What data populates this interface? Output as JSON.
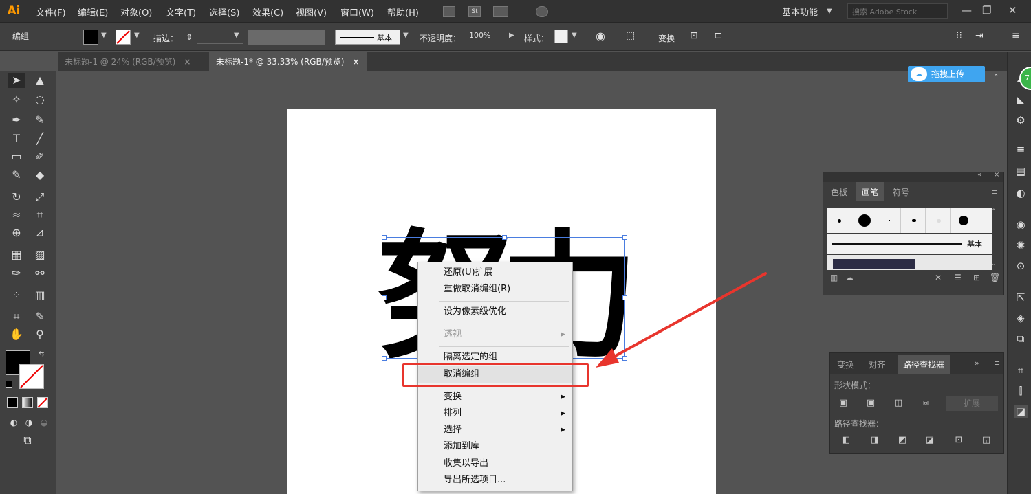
{
  "app": {
    "logo": "Ai"
  },
  "menubar": {
    "items": [
      "文件(F)",
      "编辑(E)",
      "对象(O)",
      "文字(T)",
      "选择(S)",
      "效果(C)",
      "视图(V)",
      "窗口(W)",
      "帮助(H)"
    ],
    "st_label": "St",
    "workspace": "基本功能",
    "search_placeholder": "搜索 Adobe Stock",
    "window_controls": [
      "—",
      "❐",
      "✕"
    ]
  },
  "control_bar": {
    "mode_label": "编组",
    "stroke_label": "描边：",
    "profile_label": "基本",
    "opacity_label": "不透明度：",
    "opacity_value": "100%",
    "style_label": "样式：",
    "transform_label": "变换"
  },
  "tabs": [
    {
      "label": "未标题-1 @ 24% (RGB/预览)",
      "close": "×",
      "active": false
    },
    {
      "label": "未标题-1* @ 33.33% (RGB/预览)",
      "close": "×",
      "active": true
    }
  ],
  "canvas": {
    "glyph_left": "努",
    "glyph_right": "力"
  },
  "context_menu": {
    "items": [
      {
        "label": "还原(U)扩展",
        "disabled": false,
        "submenu": false
      },
      {
        "label": "重做取消编组(R)",
        "disabled": false,
        "submenu": false
      },
      {
        "label": "设为像素级优化",
        "disabled": false,
        "submenu": false
      },
      {
        "label": "透视",
        "disabled": true,
        "submenu": true
      },
      {
        "label": "隔离选定的组",
        "disabled": false,
        "submenu": false
      },
      {
        "label": "取消编组",
        "disabled": false,
        "submenu": false,
        "highlighted": true
      },
      {
        "label": "变换",
        "disabled": false,
        "submenu": true
      },
      {
        "label": "排列",
        "disabled": false,
        "submenu": true
      },
      {
        "label": "选择",
        "disabled": false,
        "submenu": true
      },
      {
        "label": "添加到库",
        "disabled": false,
        "submenu": false
      },
      {
        "label": "收集以导出",
        "disabled": false,
        "submenu": false
      },
      {
        "label": "导出所选项目...",
        "disabled": false,
        "submenu": false
      }
    ],
    "submenu_arrow": "▶"
  },
  "upload_button": {
    "label": "拖拽上传",
    "icon": "cloud-icon"
  },
  "badge": {
    "value": "7"
  },
  "brush_panel": {
    "tabs": [
      "色板",
      "画笔",
      "符号"
    ],
    "active_tab": "画笔",
    "basic_label": "基本"
  },
  "pathfinder_panel": {
    "tabs": [
      "变换",
      "对齐",
      "路径查找器"
    ],
    "active_tab": "路径查找器",
    "shape_modes_label": "形状模式：",
    "expand_label": "扩展",
    "pathfinders_label": "路径查找器："
  },
  "colors": {
    "accent_red": "#e8352d",
    "selection_blue": "#4a7de0",
    "upload_blue": "#3fa5f0",
    "ai_orange": "#ff9a00"
  }
}
